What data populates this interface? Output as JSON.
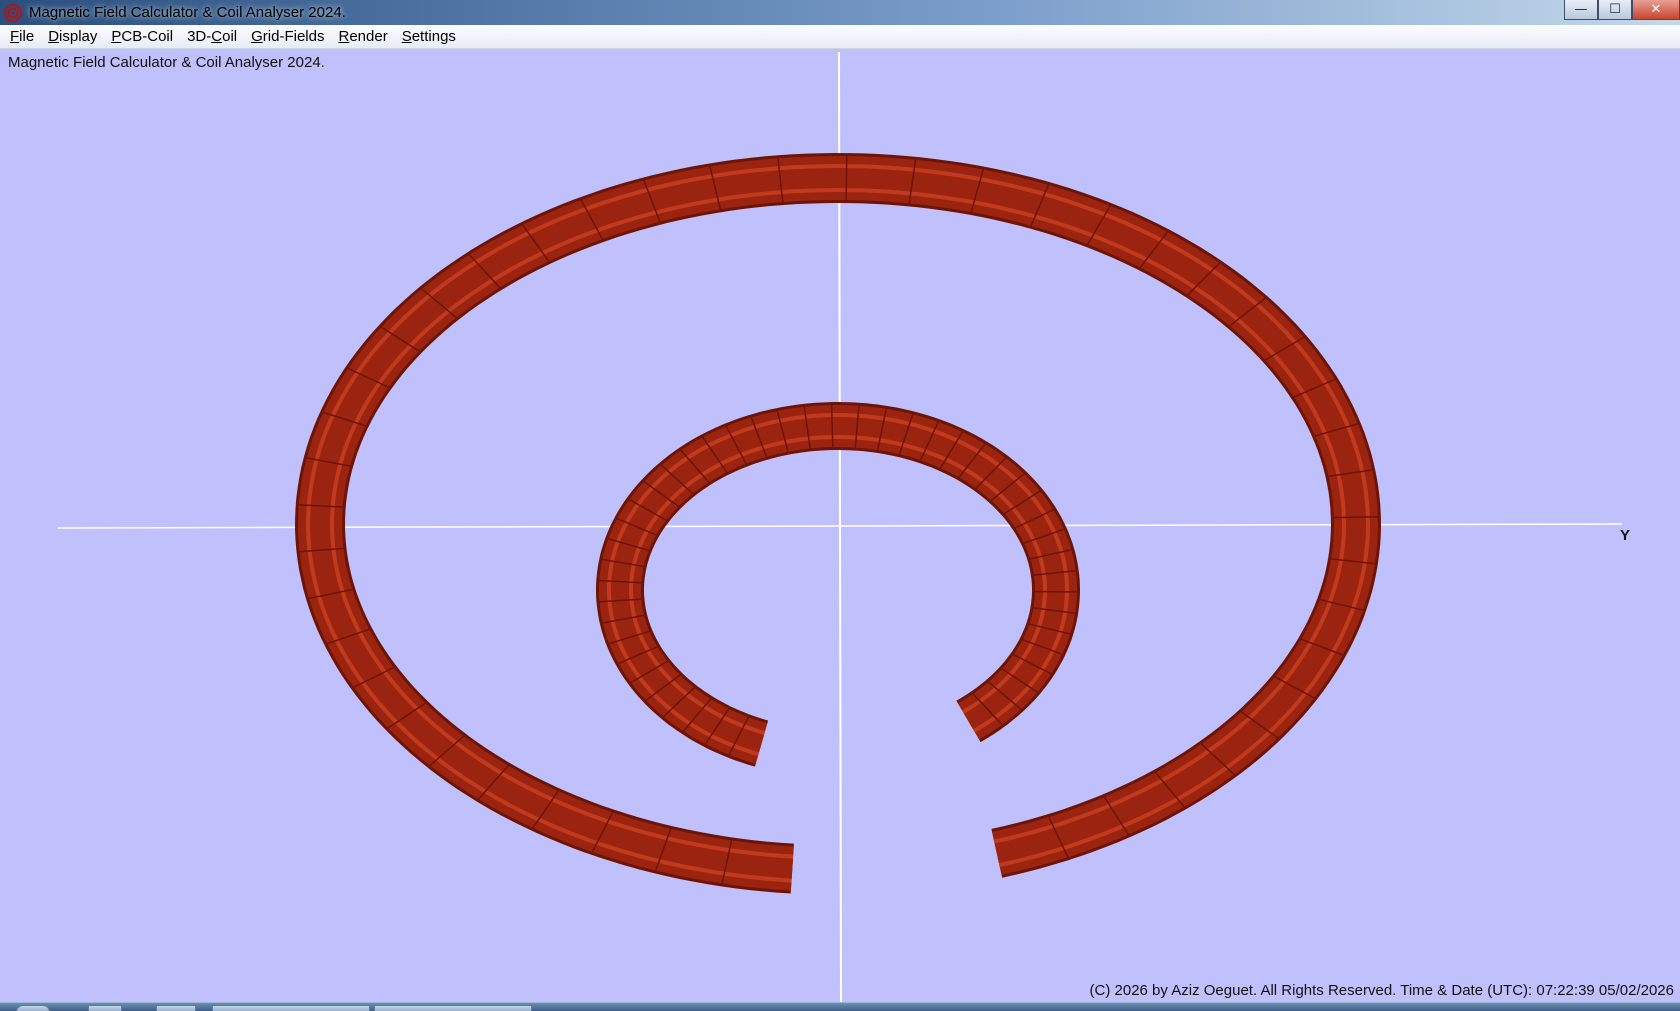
{
  "window": {
    "title": "Magnetic Field Calculator & Coil Analyser 2024.",
    "controls": {
      "minimize": "—",
      "maximize": "☐",
      "close": "✕"
    }
  },
  "menu": [
    {
      "mnemonic": "F",
      "rest": "ile"
    },
    {
      "mnemonic": "D",
      "rest": "isplay"
    },
    {
      "mnemonic": "P",
      "rest": "CB-Coil"
    },
    {
      "mnemonic": "",
      "prefix": "3D-",
      "mid": "C",
      "rest": "oil"
    },
    {
      "mnemonic": "G",
      "rest": "rid-Fields"
    },
    {
      "mnemonic": "R",
      "rest": "ender"
    },
    {
      "mnemonic": "S",
      "rest": "ettings"
    }
  ],
  "viewport": {
    "info_text": "Magnetic Field Calculator & Coil Analyser 2024.",
    "axis_label_y": "Y",
    "footer": "(C) 2026  by Aziz Oeguet. All Rights Reserved.  Time & Date (UTC): 07:22:39  05/02/2026"
  },
  "colors": {
    "background": "#c0c0fc",
    "coil": "#9a2410",
    "coil_dark": "#6e1406",
    "coil_light": "#c23a1e",
    "axis": "#ffffff"
  },
  "icons": {
    "app": "coil-app-icon"
  }
}
